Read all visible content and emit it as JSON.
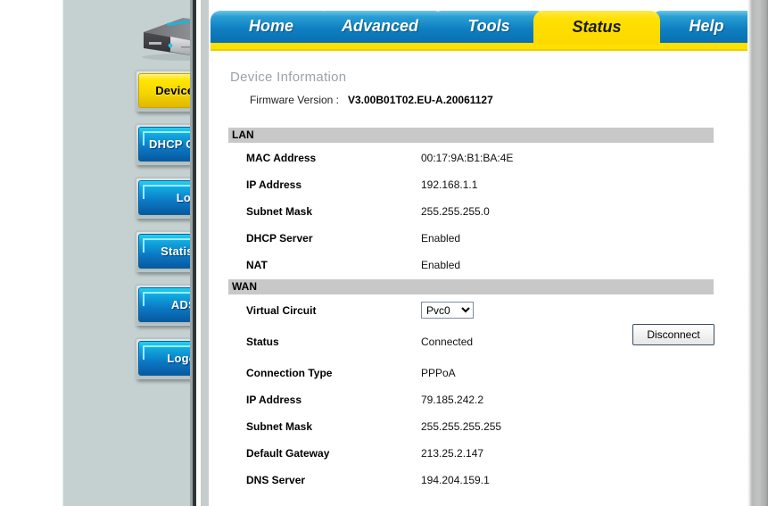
{
  "brand": {
    "device_icon": "router-product-image"
  },
  "tabs": [
    {
      "label": "Home",
      "active": false
    },
    {
      "label": "Advanced",
      "active": false
    },
    {
      "label": "Tools",
      "active": false
    },
    {
      "label": "Status",
      "active": true
    },
    {
      "label": "Help",
      "active": false
    }
  ],
  "sidebar": {
    "items": [
      {
        "label": "Device Info",
        "selected": true
      },
      {
        "label": "DHCP Clients",
        "selected": false
      },
      {
        "label": "Log",
        "selected": false
      },
      {
        "label": "Statistics",
        "selected": false
      },
      {
        "label": "ADSL",
        "selected": false
      },
      {
        "label": "Logout",
        "selected": false
      }
    ]
  },
  "main": {
    "title": "Device Information",
    "firmware": {
      "label": "Firmware Version :",
      "value": "V3.00B01T02.EU-A.20061127"
    },
    "lan": {
      "heading": "LAN",
      "rows": [
        {
          "label": "MAC Address",
          "value": "00:17:9A:B1:BA:4E"
        },
        {
          "label": "IP Address",
          "value": "192.168.1.1"
        },
        {
          "label": "Subnet Mask",
          "value": "255.255.255.0"
        },
        {
          "label": "DHCP Server",
          "value": "Enabled"
        },
        {
          "label": "NAT",
          "value": "Enabled"
        }
      ]
    },
    "wan": {
      "heading": "WAN",
      "virtual_circuit": {
        "label": "Virtual Circuit",
        "selected": "Pvc0",
        "options": [
          "Pvc0"
        ]
      },
      "disconnect_label": "Disconnect",
      "rows": [
        {
          "label": "Status",
          "value": "Connected"
        },
        {
          "label": "Connection Type",
          "value": "PPPoA"
        },
        {
          "label": "IP Address",
          "value": "79.185.242.2"
        },
        {
          "label": "Subnet Mask",
          "value": "255.255.255.255"
        },
        {
          "label": "Default Gateway",
          "value": "213.25.2.147"
        },
        {
          "label": "DNS Server",
          "value": "194.204.159.1"
        }
      ]
    }
  },
  "colors": {
    "tab_active": "#ffe000",
    "tab_inactive": "#0f80c2",
    "sidebar_bg": "#c5d0d0",
    "section_bar": "#c8c8c8",
    "selected_button": "#ffe600"
  }
}
